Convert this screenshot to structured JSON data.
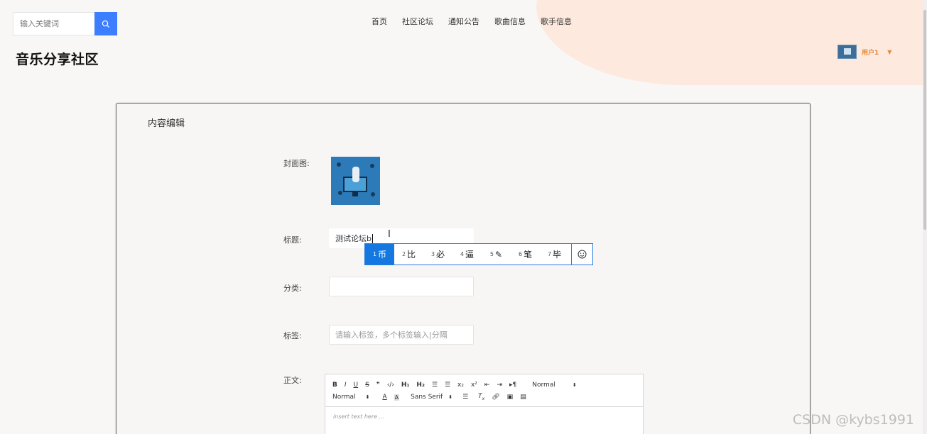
{
  "header": {
    "search_placeholder": "输入关键词",
    "nav": [
      "首页",
      "社区论坛",
      "通知公告",
      "歌曲信息",
      "歌手信息"
    ],
    "site_title": "音乐分享社区",
    "user_name": "用户1"
  },
  "form": {
    "card_title": "内容编辑",
    "cover_label": "封面图:",
    "title_label": "标题:",
    "title_value": "测试论坛b",
    "category_label": "分类:",
    "category_value": "",
    "tags_label": "标签:",
    "tags_placeholder": "请输入标签，多个标签输入|分隔",
    "body_label": "正文:"
  },
  "ime": {
    "candidates": [
      {
        "n": "1",
        "text": "币"
      },
      {
        "n": "2",
        "text": "比"
      },
      {
        "n": "3",
        "text": "必"
      },
      {
        "n": "4",
        "text": "逼"
      },
      {
        "n": "5",
        "text": "✎"
      },
      {
        "n": "6",
        "text": "笔"
      },
      {
        "n": "7",
        "text": "毕"
      }
    ],
    "emoji_icon": "smiley-icon"
  },
  "editor": {
    "row1": [
      "B",
      "I",
      "U",
      "S",
      "❞",
      "‹/›",
      "H₁",
      "H₂",
      "☰",
      "☰",
      "x₂",
      "x²",
      "⇤",
      "⇥",
      "▸¶"
    ],
    "header_select": "Normal",
    "size_select": "Normal",
    "font_select": "Sans Serif",
    "placeholder": "insert text here ..."
  },
  "watermark": "CSDN @kybs1991",
  "colors": {
    "accent": "#3d7dff",
    "ime_active": "#1478e0",
    "user": "#e58a3a",
    "blob": "#fde9dd"
  }
}
